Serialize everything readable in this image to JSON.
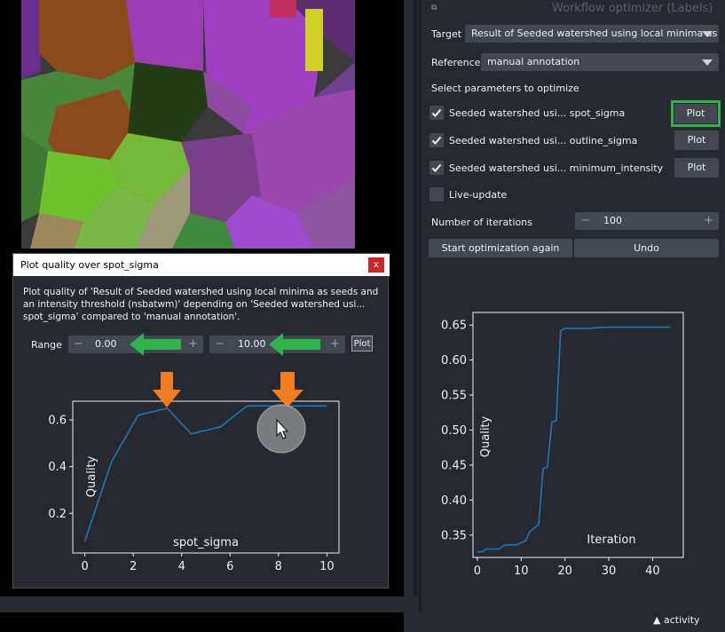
{
  "panel": {
    "title": "Workflow optimizer (Labels)",
    "target_label": "Target",
    "target_value": "Result of Seeded watershed using local minima as s",
    "reference_label": "Reference",
    "reference_value": "manual annotation",
    "select_params_label": "Select parameters to optimize",
    "params": [
      {
        "label": "Seeded watershed usi... spot_sigma",
        "checked": true,
        "button": "Plot"
      },
      {
        "label": "Seeded watershed usi... outline_sigma",
        "checked": true,
        "button": "Plot"
      },
      {
        "label": "Seeded watershed usi... minimum_intensity",
        "checked": true,
        "button": "Plot"
      }
    ],
    "live_update_label": "Live-update",
    "iterations_label": "Number of iterations",
    "iterations_value": "100",
    "start_button": "Start optimization again",
    "undo_button": "Undo"
  },
  "dialog": {
    "title": "Plot quality over spot_sigma",
    "close": "x",
    "description": "Plot quality of 'Result of Seeded watershed using local minima as seeds and an intensity threshold (nsbatwm)' depending on 'Seeded watershed usi... spot_sigma' compared to 'manual annotation'.",
    "range_label": "Range",
    "range_min": "0.00",
    "range_max": "10.00",
    "plot_button": "Plot"
  },
  "footer": {
    "activity": "activity"
  },
  "colors": {
    "accent_green": "#2fb34a",
    "arrow_orange": "#f47c20",
    "line_blue": "#1f77b4",
    "bg": "#262930"
  },
  "chart_data": [
    {
      "type": "line",
      "xlabel": "spot_sigma",
      "ylabel": "Quality",
      "x": [
        0,
        1.1,
        2.2,
        3.4,
        4.4,
        5.6,
        6.7,
        7.8,
        8.9,
        10
      ],
      "values": [
        0.08,
        0.42,
        0.62,
        0.65,
        0.54,
        0.57,
        0.66,
        0.66,
        0.66,
        0.66
      ],
      "xticks": [
        0,
        2,
        4,
        6,
        8,
        10
      ],
      "yticks": [
        0.2,
        0.4,
        0.6
      ],
      "xlim": [
        -0.5,
        10.5
      ],
      "ylim": [
        0.03,
        0.68
      ]
    },
    {
      "type": "line",
      "xlabel": "Iteration",
      "ylabel": "Quality",
      "x": [
        0,
        1,
        2,
        3,
        5,
        6,
        7,
        9,
        10,
        11,
        12,
        13,
        14,
        15,
        16,
        17,
        18,
        19,
        20,
        25,
        27,
        30,
        44
      ],
      "values": [
        0.326,
        0.326,
        0.33,
        0.33,
        0.33,
        0.335,
        0.336,
        0.336,
        0.339,
        0.342,
        0.355,
        0.36,
        0.365,
        0.445,
        0.447,
        0.512,
        0.513,
        0.642,
        0.645,
        0.645,
        0.646,
        0.647,
        0.647
      ],
      "xticks": [
        0,
        10,
        20,
        30,
        40
      ],
      "yticks": [
        0.35,
        0.4,
        0.45,
        0.5,
        0.55,
        0.6,
        0.65
      ],
      "xlim": [
        -1,
        47
      ],
      "ylim": [
        0.318,
        0.668
      ]
    }
  ]
}
